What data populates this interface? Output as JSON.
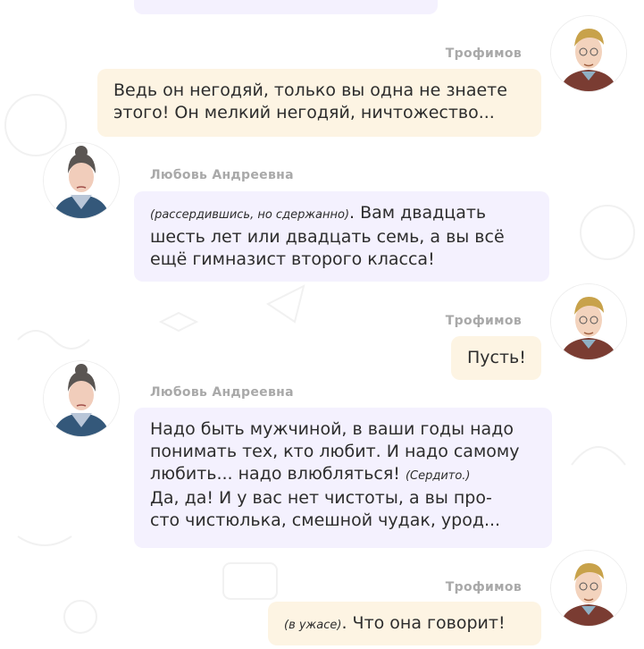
{
  "chat": {
    "messages": [
      {
        "speaker": "Трофимов",
        "lines": [
          "Ведь он негодяй, только вы одна не знаете",
          "этого! Он мелкий негодяй, ничтожество..."
        ]
      },
      {
        "speaker": "Любовь Андреевна",
        "remark": "(рассердившись, но сдержанно)",
        "after_remark": ". Вам двадцать",
        "lines": [
          "шесть лет или двадцать семь, а вы всё",
          "ещё гимназист второго класса!"
        ]
      },
      {
        "speaker": "Трофимов",
        "lines": [
          "Пусть!"
        ]
      },
      {
        "speaker": "Любовь Андреевна",
        "lines": [
          "Надо быть мужчиной, в ваши годы надо",
          "понимать тех, кто любит. И надо самому",
          "любить... надо влюбляться!",
          "Да, да! И у вас нет чистоты, а вы про-",
          "сто чистюлька, смешной чудак, урод..."
        ],
        "remark": "(Сердито.)"
      },
      {
        "speaker": "Трофимов",
        "remark": "(в ужасе)",
        "after_remark": ". Что она говорит!"
      }
    ]
  },
  "colors": {
    "bubble_trofimov": "#fdf4e3",
    "bubble_lyubov": "#f4f1fe",
    "speaker_name": "#a9a9a9",
    "text": "#2d2d2d"
  }
}
